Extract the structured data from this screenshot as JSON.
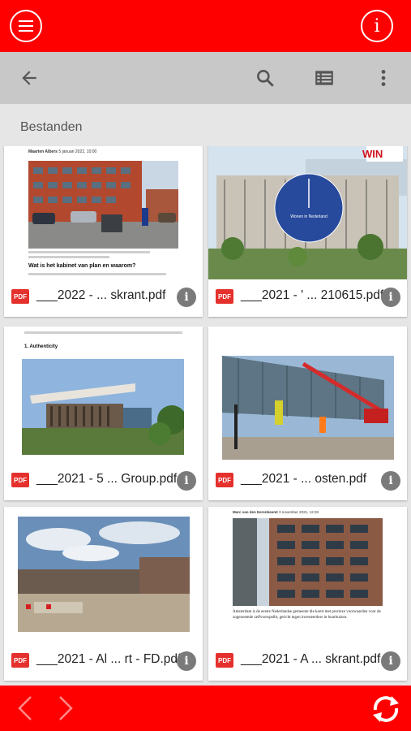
{
  "colors": {
    "primary": "#ff0000",
    "toolbar": "#c8c8c8",
    "background": "#e6e6e6"
  },
  "topbar": {
    "menu_icon": "hamburger-menu-icon",
    "info_icon": "info-circle-icon",
    "info_glyph": "i"
  },
  "toolbar": {
    "back_icon": "arrow-left-icon",
    "search_icon": "search-icon",
    "list_icon": "list-view-icon",
    "more_icon": "more-vertical-icon"
  },
  "section": {
    "title": "Bestanden"
  },
  "files": [
    {
      "name": "___2022 - ... skrant.pdf",
      "badge": "PDF"
    },
    {
      "name": "___2021 - ' ... 210615.pdf",
      "badge": "PDF"
    },
    {
      "name": "___2021 - 5 ... Group.pdf",
      "badge": "PDF"
    },
    {
      "name": "___2021 - ... osten.pdf",
      "badge": "PDF"
    },
    {
      "name": "___2021 - Al ... rt - FD.pdf",
      "badge": "PDF"
    },
    {
      "name": "___2021 - A ... skrant.pdf",
      "badge": "PDF"
    }
  ],
  "thumb_text": {
    "t1_author": "Maarten Albers",
    "t1_date": "5 januari 2022, 10:00",
    "t1_heading": "Wat is het kabinet van plan en waarom?",
    "t2_logo": "WIN",
    "t2_clock_text": "Wonen in Nederland",
    "t3_heading": "1. Authenticity",
    "t6_author": "Marc van den Eerenbeemt",
    "t6_date": "3 november 2021, 12:28",
    "t6_body": "Amsterdam is de eerste Nederlandse gemeente die komt met precieze voorwaarden voor de zogenoemde zelfvoorspelbt, gericht tegen investeerders in huurhuizen."
  },
  "bottombar": {
    "prev_icon": "chevron-left-icon",
    "next_icon": "chevron-right-icon",
    "refresh_icon": "refresh-icon"
  }
}
